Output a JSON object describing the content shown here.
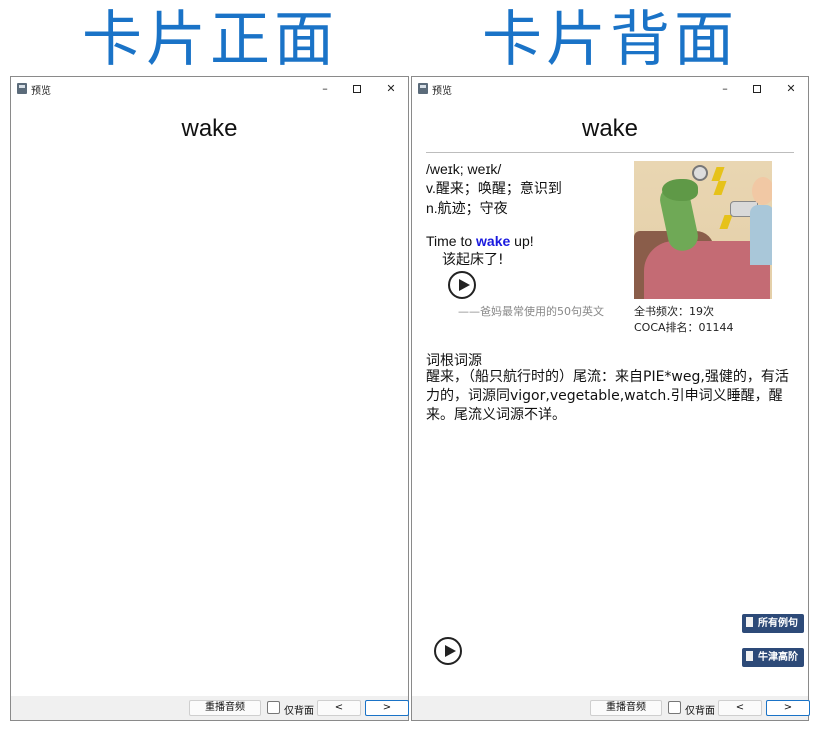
{
  "headings": {
    "front": "卡片正面",
    "back": "卡片背面"
  },
  "window": {
    "title": "预览",
    "min_glyph": "–",
    "close_glyph": "✕"
  },
  "card": {
    "word": "wake",
    "phonetic": "/weɪk; weɪk/",
    "definitions": [
      "v.醒来；唤醒；意识到",
      "n.航迹；守夜"
    ],
    "example": {
      "before": "Time to ",
      "word": "wake",
      "after": " up!"
    },
    "example_translation": "该起床了!",
    "source": "——爸妈最常使用的50句英文",
    "frequency": "全书频次：19次",
    "coca_rank": "COCA排名：01144",
    "etymology_title": "词根词源",
    "etymology_text": "醒来，（船只航行时的）尾流：来自PIE*weg,强健的，有活力的，词源同vigor,vegetable,watch.引申词义睡醒，醒来。尾流义词源不详。"
  },
  "side_buttons": {
    "examples": "所有例句",
    "oxford": "牛津高阶"
  },
  "bottom_bar": {
    "replay": "重播音频",
    "back_only": "仅背面",
    "prev": "<",
    "next": ">"
  },
  "icons": {
    "app": "app-icon",
    "play": "play-icon",
    "document": "document-icon"
  },
  "colors": {
    "heading": "#1a73c7",
    "example_word": "#1a1adf",
    "side_button": "#2d4a78"
  }
}
